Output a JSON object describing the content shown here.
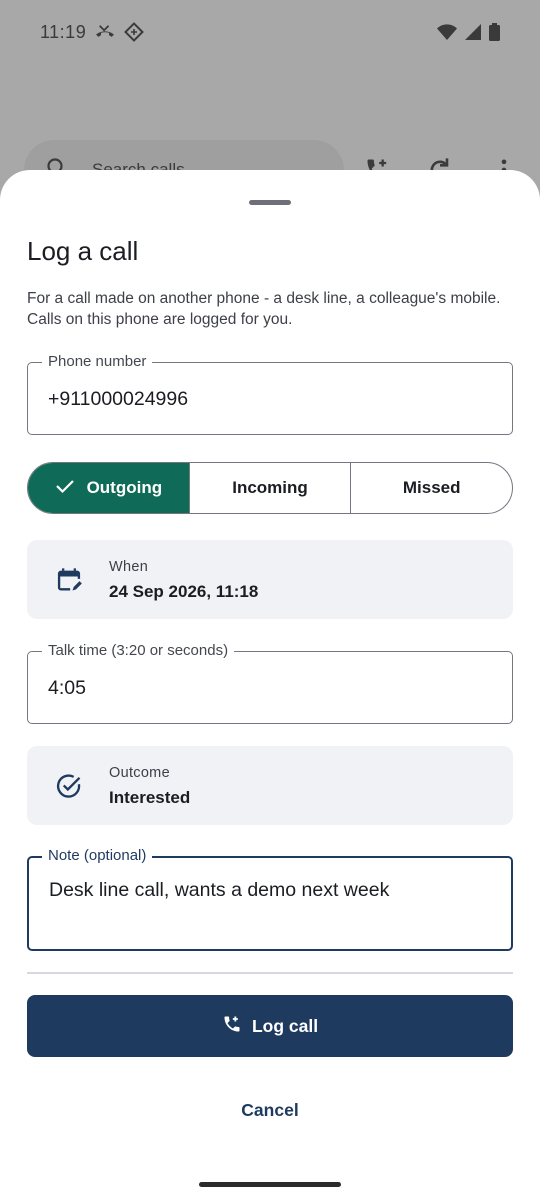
{
  "status_bar": {
    "time": "11:19",
    "icons": [
      "missed-call-icon",
      "app-notification-icon",
      "wifi-icon",
      "signal-icon",
      "battery-icon"
    ]
  },
  "background_app": {
    "search_placeholder": "Search calls",
    "icons": [
      "search-icon",
      "add-call-icon",
      "refresh-icon",
      "more-vert-icon"
    ]
  },
  "sheet": {
    "title": "Log a call",
    "description": "For a call made on another phone - a desk line, a colleague's mobile. Calls on this phone are logged for you.",
    "phone_field": {
      "label": "Phone number",
      "value": "+911000024996"
    },
    "direction": {
      "options": [
        "Outgoing",
        "Incoming",
        "Missed"
      ],
      "selected": "Outgoing"
    },
    "when": {
      "label": "When",
      "value": "24 Sep 2026, 11:18",
      "icon": "calendar-edit-icon"
    },
    "talk_time_field": {
      "label": "Talk time (3:20 or seconds)",
      "value": "4:05"
    },
    "outcome": {
      "label": "Outcome",
      "value": "Interested",
      "icon": "check-circle-icon"
    },
    "note_field": {
      "label": "Note (optional)",
      "value": "Desk line call, wants a demo next week"
    },
    "primary_button": {
      "label": "Log call",
      "icon": "add-call-icon"
    },
    "cancel_button": {
      "label": "Cancel"
    }
  },
  "colors": {
    "selected_segment": "#0f6b57",
    "primary": "#1f3a5f",
    "card_bg": "#f0f2f5"
  }
}
